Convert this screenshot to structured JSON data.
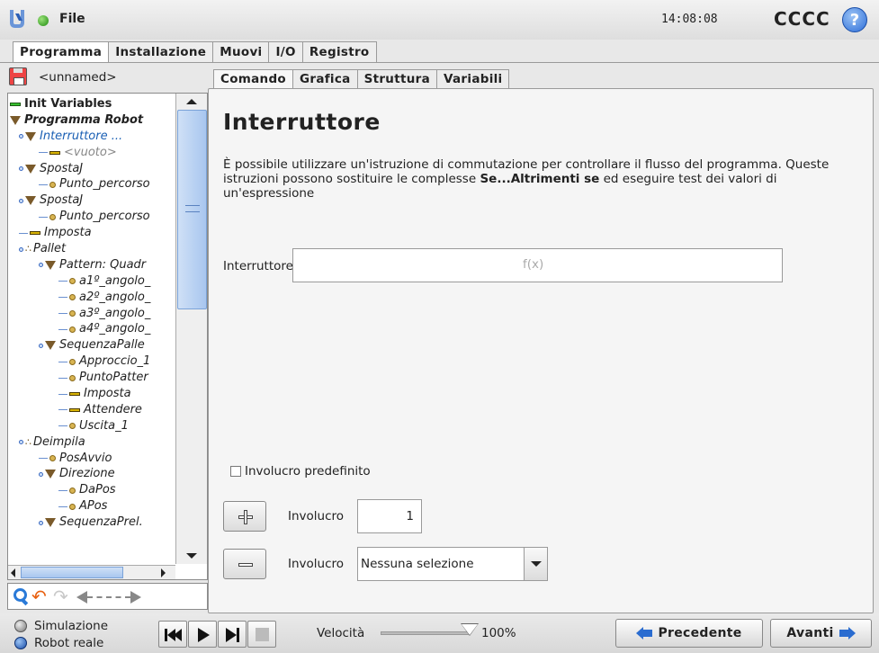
{
  "header": {
    "file_label": "File",
    "clock": "14:08:08",
    "robot_name": "CCCC",
    "help_label": "?"
  },
  "main_tabs": [
    {
      "label": "Programma",
      "active": true
    },
    {
      "label": "Installazione",
      "active": false
    },
    {
      "label": "Muovi",
      "active": false
    },
    {
      "label": "I/O",
      "active": false
    },
    {
      "label": "Registro",
      "active": false
    }
  ],
  "program": {
    "name": "<unnamed>"
  },
  "tree": [
    {
      "label": "Init Variables",
      "icon": "bar-green",
      "depth": 0,
      "style": "normal"
    },
    {
      "label": "Programma Robot",
      "icon": "triangle",
      "depth": 0,
      "style": "bold"
    },
    {
      "label": "Interruttore ...",
      "icon": "triangle",
      "depth": 1,
      "style": "selected"
    },
    {
      "label": "<vuoto>",
      "icon": "bar-set",
      "depth": 2,
      "style": "muted"
    },
    {
      "label": "SpostaJ",
      "icon": "triangle",
      "depth": 1,
      "style": ""
    },
    {
      "label": "Punto_percorso",
      "icon": "dot",
      "depth": 2,
      "style": ""
    },
    {
      "label": "SpostaJ",
      "icon": "triangle",
      "depth": 1,
      "style": ""
    },
    {
      "label": "Punto_percorso",
      "icon": "dot",
      "depth": 2,
      "style": ""
    },
    {
      "label": "Imposta",
      "icon": "bar-set",
      "depth": 1,
      "style": ""
    },
    {
      "label": "Pallet",
      "icon": "dots",
      "depth": 1,
      "style": ""
    },
    {
      "label": "Pattern: Quadr",
      "icon": "triangle",
      "depth": 2,
      "style": ""
    },
    {
      "label": "a1º_angolo_",
      "icon": "dot",
      "depth": 3,
      "style": ""
    },
    {
      "label": "a2º_angolo_",
      "icon": "dot",
      "depth": 3,
      "style": ""
    },
    {
      "label": "a3º_angolo_",
      "icon": "dot",
      "depth": 3,
      "style": ""
    },
    {
      "label": "a4º_angolo_",
      "icon": "dot",
      "depth": 3,
      "style": ""
    },
    {
      "label": "SequenzaPalle",
      "icon": "triangle",
      "depth": 2,
      "style": ""
    },
    {
      "label": "Approccio_1",
      "icon": "dot",
      "depth": 3,
      "style": ""
    },
    {
      "label": "PuntoPatter",
      "icon": "dot",
      "depth": 3,
      "style": ""
    },
    {
      "label": "Imposta",
      "icon": "bar-set",
      "depth": 3,
      "style": ""
    },
    {
      "label": "Attendere",
      "icon": "bar-set",
      "depth": 3,
      "style": ""
    },
    {
      "label": "Uscita_1",
      "icon": "dot",
      "depth": 3,
      "style": ""
    },
    {
      "label": "Deimpila",
      "icon": "dots",
      "depth": 1,
      "style": ""
    },
    {
      "label": "PosAvvio",
      "icon": "dot",
      "depth": 2,
      "style": ""
    },
    {
      "label": "Direzione",
      "icon": "triangle",
      "depth": 2,
      "style": ""
    },
    {
      "label": "DaPos",
      "icon": "dot",
      "depth": 3,
      "style": ""
    },
    {
      "label": "APos",
      "icon": "dot",
      "depth": 3,
      "style": ""
    },
    {
      "label": "SequenzaPrel.",
      "icon": "triangle",
      "depth": 2,
      "style": ""
    }
  ],
  "sub_tabs": [
    {
      "label": "Comando",
      "active": true
    },
    {
      "label": "Grafica",
      "active": false
    },
    {
      "label": "Struttura",
      "active": false
    },
    {
      "label": "Variabili",
      "active": false
    }
  ],
  "command": {
    "title": "Interruttore",
    "desc_part1": "È possibile utilizzare un'istruzione di commutazione per controllare il flusso del programma. Queste istruzioni possono sostituire le complesse ",
    "desc_bold": "Se...Altrimenti se",
    "desc_part2": " ed eseguire test dei valori di un'espressione",
    "expression_label": "Interruttore",
    "expression_placeholder": "f(x)",
    "default_case_label": "Involucro predefinito",
    "default_case_checked": false,
    "add_case_label": "Involucro",
    "add_case_value": "1",
    "remove_case_label": "Involucro",
    "remove_case_selected": "Nessuna selezione"
  },
  "footer": {
    "mode_simulation": "Simulazione",
    "mode_real": "Robot reale",
    "speed_label": "Velocità",
    "speed_value": "100%",
    "speed_fraction": 1.0,
    "prev_label": "Precedente",
    "next_label": "Avanti"
  }
}
